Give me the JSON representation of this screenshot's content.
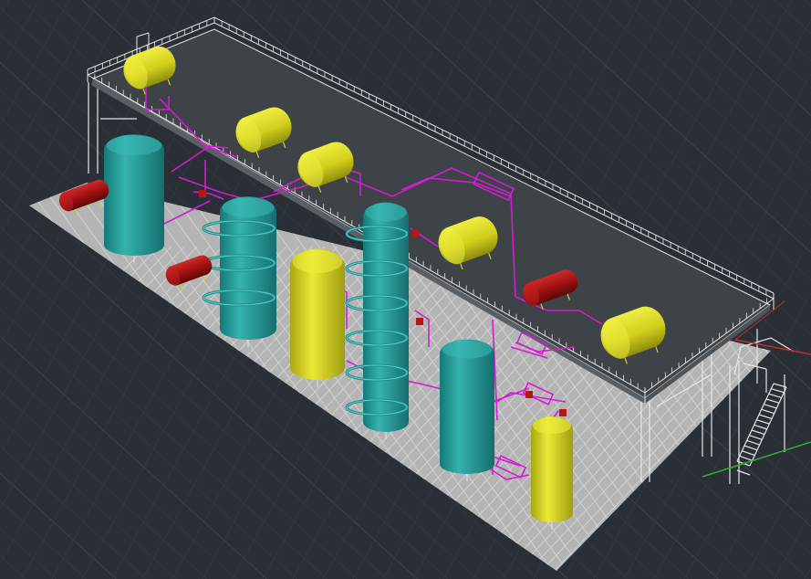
{
  "viewport": {
    "background": "#2a2e35",
    "grid_minor": "#323740",
    "grid_major": "#3b414b"
  },
  "colors": {
    "floor": "#b4b4b4",
    "floor_grid": "#d4d4d4",
    "deck": "#3e4348",
    "railing": "#e6e6e6",
    "vessel_teal": "#2a9a98",
    "vessel_yellow": "#d7d51e",
    "vessel_red": "#a31515",
    "pipe_magenta": "#d21cd4",
    "axis_red": "#c0302a",
    "axis_green": "#2fae3a"
  },
  "scene": {
    "vertical_vessels": [
      {
        "name": "teal-vessel",
        "color": "teal"
      },
      {
        "name": "teal-column",
        "color": "teal"
      },
      {
        "name": "yellow-tower",
        "color": "yellow"
      },
      {
        "name": "teal-column",
        "color": "teal"
      },
      {
        "name": "teal-vessel",
        "color": "teal"
      },
      {
        "name": "yellow-vessel",
        "color": "yellow"
      }
    ],
    "horizontal_tanks": [
      {
        "name": "yellow-tank",
        "color": "yellow"
      },
      {
        "name": "yellow-tank",
        "color": "yellow"
      },
      {
        "name": "yellow-tank",
        "color": "yellow"
      },
      {
        "name": "yellow-tank",
        "color": "yellow"
      },
      {
        "name": "yellow-tank",
        "color": "yellow"
      },
      {
        "name": "red-tank",
        "color": "red"
      },
      {
        "name": "red-tank",
        "color": "red"
      },
      {
        "name": "red-tank",
        "color": "red"
      }
    ]
  }
}
